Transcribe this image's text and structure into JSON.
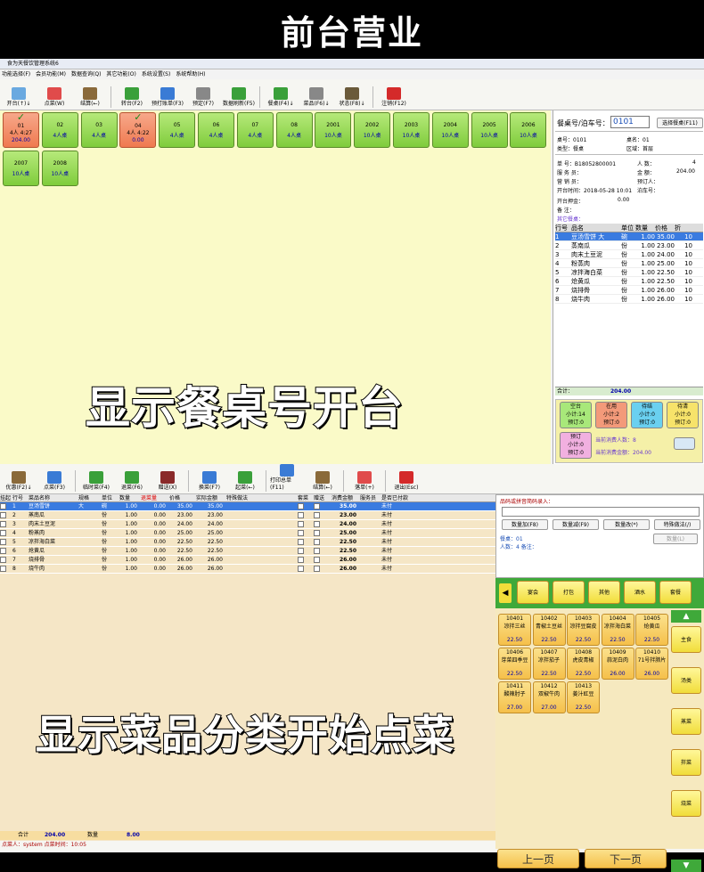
{
  "header_title": "前台营业",
  "win1": {
    "title": "食为天餐饮管理系统6",
    "menu": [
      "功能选择(F)",
      "会员功能(M)",
      "数据查询(Q)",
      "其它功能(O)",
      "系统设置(S)",
      "系统帮助(H)"
    ],
    "toolbar": [
      {
        "label": "开台(↑)↓",
        "icon": "open-table-icon",
        "color": "#6aa9e0"
      },
      {
        "label": "点菜(W)",
        "icon": "order-icon",
        "color": "#e04b4b"
      },
      {
        "label": "结算(←)",
        "icon": "checkout-icon",
        "color": "#8a6a3a"
      },
      {
        "label": "转台(F2)",
        "icon": "transfer-icon",
        "color": "#3aa03a"
      },
      {
        "label": "预打账单(F3)",
        "icon": "print-bill-icon",
        "color": "#3a7bd5"
      },
      {
        "label": "预定(F7)",
        "icon": "reserve-icon",
        "color": "#888"
      },
      {
        "label": "数据刷新(F5)",
        "icon": "refresh-icon",
        "color": "#3aa03a"
      },
      {
        "label": "餐桌(F4)↓",
        "icon": "table-icon",
        "color": "#3aa03a"
      },
      {
        "label": "菜品(F6)↓",
        "icon": "dish-icon",
        "color": "#888"
      },
      {
        "label": "状态(F8)↓",
        "icon": "status-icon",
        "color": "#6a5a3a"
      },
      {
        "label": "注销(F12)",
        "icon": "logout-icon",
        "color": "#d42a2a"
      }
    ],
    "tables": [
      {
        "no": "01",
        "info": "4人 4:27",
        "amount": "204.00",
        "busy": true
      },
      {
        "no": "02",
        "cap": "4人桌"
      },
      {
        "no": "03",
        "cap": "4人桌"
      },
      {
        "no": "04",
        "info": "4人 4:22",
        "amount": "0.00",
        "busy": true
      },
      {
        "no": "05",
        "cap": "4人桌"
      },
      {
        "no": "06",
        "cap": "4人桌"
      },
      {
        "no": "07",
        "cap": "4人桌"
      },
      {
        "no": "08",
        "cap": "4人桌"
      },
      {
        "no": "2001",
        "cap": "10人桌"
      },
      {
        "no": "2002",
        "cap": "10人桌"
      },
      {
        "no": "2003",
        "cap": "10人桌"
      },
      {
        "no": "2004",
        "cap": "10人桌"
      },
      {
        "no": "2005",
        "cap": "10人桌"
      },
      {
        "no": "2006",
        "cap": "10人桌"
      },
      {
        "no": "2007",
        "cap": "10人桌"
      },
      {
        "no": "2008",
        "cap": "10人桌"
      }
    ],
    "right": {
      "search_label": "餐桌号/泊车号：",
      "search_value": "0101",
      "select_btn": "选择餐桌(F11)",
      "table_no": "桌号：0101",
      "table_name": "桌名：01",
      "type": "类型：餐桌",
      "area": "区域：首层",
      "bill": "单   号：B18052800001",
      "people": "人   数：",
      "people_val": "4",
      "server": "服 务 员：",
      "amount": "金   额：",
      "amount_val": "204.00",
      "sales": "营 销 员：",
      "booker": "预订人：",
      "open_time": "开台时间：2018-05-28 10:01",
      "parking": "泊车号：",
      "deposit": "开台押金：",
      "deposit_val": "0.00",
      "remark": "备   注：",
      "other": "其它餐桌：",
      "cols": [
        "行号",
        "品名",
        "单位",
        "数量",
        "价格",
        "折"
      ],
      "rows": [
        [
          "1",
          "豆汤雪饼 大",
          "碗",
          "1.00",
          "35.00",
          "10"
        ],
        [
          "2",
          "蒸南瓜",
          "份",
          "1.00",
          "23.00",
          "10"
        ],
        [
          "3",
          "肉末土豆泥",
          "份",
          "1.00",
          "24.00",
          "10"
        ],
        [
          "4",
          "粉蒸肉",
          "份",
          "1.00",
          "25.00",
          "10"
        ],
        [
          "5",
          "凉拌海白菜",
          "份",
          "1.00",
          "22.50",
          "10"
        ],
        [
          "6",
          "炝黄瓜",
          "份",
          "1.00",
          "22.50",
          "10"
        ],
        [
          "7",
          "烧排骨",
          "份",
          "1.00",
          "26.00",
          "10"
        ],
        [
          "8",
          "烧牛肉",
          "份",
          "1.00",
          "26.00",
          "10"
        ]
      ],
      "total_label": "合计：",
      "total_val": "204.00",
      "status": [
        {
          "t": "空台",
          "a": "小计:14",
          "b": "预订:0",
          "color": "#a8e87a"
        },
        {
          "t": "在用",
          "a": "小计:2",
          "b": "预订:0",
          "color": "#f39a7a"
        },
        {
          "t": "待结",
          "a": "小计:0",
          "b": "预订:0",
          "color": "#6ad0f0"
        },
        {
          "t": "待清",
          "a": "小计:0",
          "b": "预订:0",
          "color": "#f7e36a"
        },
        {
          "t": "预订",
          "a": "小计:0",
          "b": "预订:0",
          "color": "#f1b0e0"
        }
      ],
      "cur_people": "当前消费人数：8",
      "cur_amount": "当前消费金额：204.00"
    },
    "overlay": "显示餐桌号开台"
  },
  "win2": {
    "toolbar": [
      {
        "label": "优惠(F2)↓",
        "icon": "discount-icon",
        "color": "#8a6a3a"
      },
      {
        "label": "点菜(F3)",
        "icon": "order-icon",
        "color": "#3a7bd5"
      },
      {
        "label": "临时菜(F4)",
        "icon": "temp-dish-icon",
        "color": "#3aa03a"
      },
      {
        "label": "退菜(F6)",
        "icon": "return-dish-icon",
        "color": "#3aa03a"
      },
      {
        "label": "赠送(X)",
        "icon": "gift-icon",
        "color": "#8a2a2a"
      },
      {
        "label": "换菜(F7)",
        "icon": "swap-dish-icon",
        "color": "#3a7bd5"
      },
      {
        "label": "起菜(←)",
        "icon": "serve-icon",
        "color": "#3aa03a"
      },
      {
        "label": "打印总单(F11)",
        "icon": "print-icon",
        "color": "#3a7bd5"
      },
      {
        "label": "结算(←)",
        "icon": "checkout-icon",
        "color": "#8a6a3a"
      },
      {
        "label": "落单(+)",
        "icon": "submit-icon",
        "color": "#e04b4b"
      },
      {
        "label": "退出(Esc)",
        "icon": "exit-icon",
        "color": "#d42a2a"
      }
    ],
    "cols": [
      "挂起",
      "行号",
      "菜品名称",
      "规格",
      "单位",
      "数量",
      "退菜量",
      "价格",
      "实际金额",
      "特殊做法",
      "套菜",
      "赠送",
      "消费金额",
      "服务员",
      "是否已付款"
    ],
    "rows": [
      [
        "1",
        "豆汤雪饼",
        "大",
        "碗",
        "1.00",
        "0.00",
        "35.00",
        "35.00",
        "35.00",
        "未付"
      ],
      [
        "2",
        "蒸南瓜",
        "",
        "份",
        "1.00",
        "0.00",
        "23.00",
        "23.00",
        "23.00",
        "未付"
      ],
      [
        "3",
        "肉末土豆泥",
        "",
        "份",
        "1.00",
        "0.00",
        "24.00",
        "24.00",
        "24.00",
        "未付"
      ],
      [
        "4",
        "粉蒸肉",
        "",
        "份",
        "1.00",
        "0.00",
        "25.00",
        "25.00",
        "25.00",
        "未付"
      ],
      [
        "5",
        "凉拌海白菜",
        "",
        "份",
        "1.00",
        "0.00",
        "22.50",
        "22.50",
        "22.50",
        "未付"
      ],
      [
        "6",
        "炝黄瓜",
        "",
        "份",
        "1.00",
        "0.00",
        "22.50",
        "22.50",
        "22.50",
        "未付"
      ],
      [
        "7",
        "烧排骨",
        "",
        "份",
        "1.00",
        "0.00",
        "26.00",
        "26.00",
        "26.00",
        "未付"
      ],
      [
        "8",
        "烧牛肉",
        "",
        "份",
        "1.00",
        "0.00",
        "26.00",
        "26.00",
        "26.00",
        "未付"
      ]
    ],
    "total_label": "合计",
    "total_val": "204.00",
    "qty_label": "数量",
    "qty_val": "8.00",
    "footer": "点菜人：system  点菜时间：10:05",
    "right": {
      "code_label": "品码或拼音简码录入：",
      "btns": [
        "数量加(F8)",
        "数量减(F9)",
        "数量改(*)",
        "特殊做法(/)"
      ],
      "disabled_btn": "数量(L)",
      "table": "餐桌：01",
      "people": "人数：4  备注：",
      "cats": [
        "宴会",
        "打包",
        "其他",
        "酒水",
        "套餐"
      ],
      "dishes": [
        {
          "code": "10401",
          "name": "凉拌三丝",
          "price": "22.50"
        },
        {
          "code": "10402",
          "name": "青椒土豆丝",
          "price": "22.50"
        },
        {
          "code": "10403",
          "name": "凉拌豆腐皮",
          "price": "22.50"
        },
        {
          "code": "10404",
          "name": "凉拌海白菜",
          "price": "22.50"
        },
        {
          "code": "10405",
          "name": "炝黄瓜",
          "price": "22.50"
        },
        {
          "code": "10406",
          "name": "芽菜四季豆",
          "price": "22.50"
        },
        {
          "code": "10407",
          "name": "凉拌茄子",
          "price": "22.50"
        },
        {
          "code": "10408",
          "name": "虎皮青椒",
          "price": "22.50"
        },
        {
          "code": "10409",
          "name": "蒜泥白肉",
          "price": "26.00"
        },
        {
          "code": "10410",
          "name": "71号拌肺片",
          "price": "26.00"
        },
        {
          "code": "10411",
          "name": "酸辣肘子",
          "price": "27.00"
        },
        {
          "code": "10412",
          "name": "双椒牛肉",
          "price": "27.00"
        },
        {
          "code": "10413",
          "name": "姜汁豇豆",
          "price": "22.50"
        }
      ],
      "side": [
        "主食",
        "汤类",
        "蒸菜",
        "拌菜",
        "烧菜"
      ],
      "prev": "上一页",
      "next": "下一页"
    },
    "overlay": "显示菜品分类开始点菜"
  }
}
